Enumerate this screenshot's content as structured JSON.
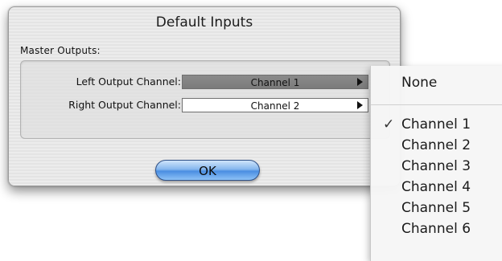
{
  "dialog": {
    "title": "Default Inputs",
    "group_label": "Master Outputs:",
    "rows": [
      {
        "label": "Left Output Channel:",
        "value": "Channel 1"
      },
      {
        "label": "Right Output Channel:",
        "value": "Channel 2"
      }
    ],
    "ok_label": "OK"
  },
  "menu": {
    "none_label": "None",
    "check_mark": "✓",
    "items": [
      {
        "label": "Channel 1",
        "checked": true
      },
      {
        "label": "Channel 2",
        "checked": false
      },
      {
        "label": "Channel 3",
        "checked": false
      },
      {
        "label": "Channel 4",
        "checked": false
      },
      {
        "label": "Channel 5",
        "checked": false
      },
      {
        "label": "Channel 6",
        "checked": false
      }
    ]
  },
  "colors": {
    "ok_button": "#4a8ee2",
    "active_popup": "#7b7b7b"
  }
}
